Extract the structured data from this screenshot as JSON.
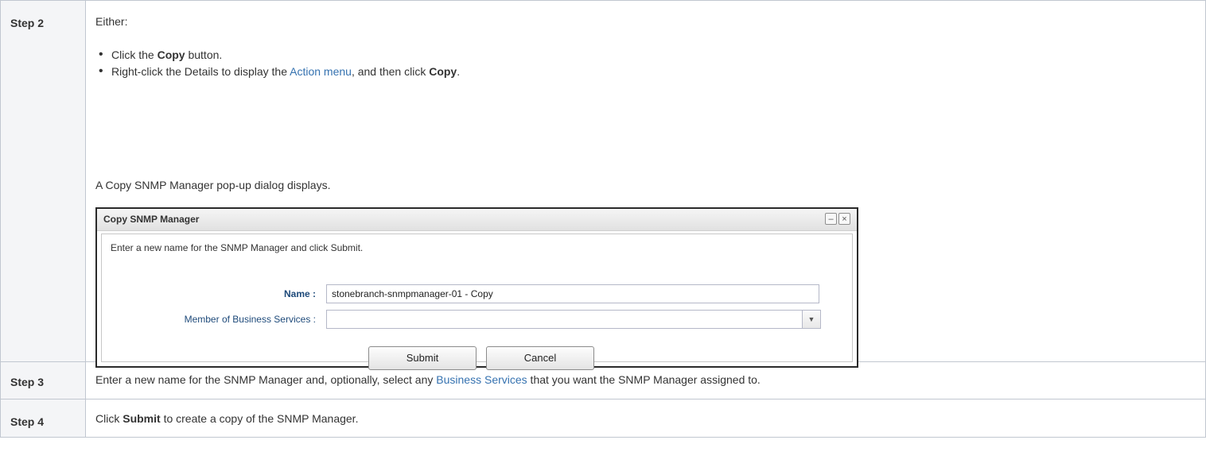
{
  "steps": [
    {
      "label": "Step 2",
      "lead": "Either:",
      "bullets": [
        {
          "pre": "Click the ",
          "bold": "Copy",
          "post": " button."
        },
        {
          "pre": "Right-click the Details to display the ",
          "link": "Action menu",
          "mid": ", and then click ",
          "bold": "Copy",
          "post": "."
        }
      ],
      "note": "A Copy SNMP Manager pop-up dialog displays."
    },
    {
      "label": "Step 3",
      "pre": "Enter a new name for the SNMP Manager and, optionally, select any ",
      "link": "Business Services",
      "post": " that you want the SNMP Manager assigned to."
    },
    {
      "label": "Step 4",
      "bold": "Submit",
      "post": " to create a copy of the SNMP Manager.",
      "pre": "Click "
    }
  ],
  "dialog": {
    "title": "Copy SNMP Manager",
    "minimize_glyph": "–",
    "close_glyph": "×",
    "instruction": "Enter a new name for the SNMP Manager and click Submit.",
    "name_label": "Name :",
    "name_value": "stonebranch-snmpmanager-01 - Copy",
    "member_label": "Member of Business Services :",
    "member_value": "",
    "submit_label": "Submit",
    "cancel_label": "Cancel"
  },
  "colors": {
    "link": "#3572b0",
    "label_cell_bg": "#f4f5f7",
    "border": "#c1c7d0"
  }
}
